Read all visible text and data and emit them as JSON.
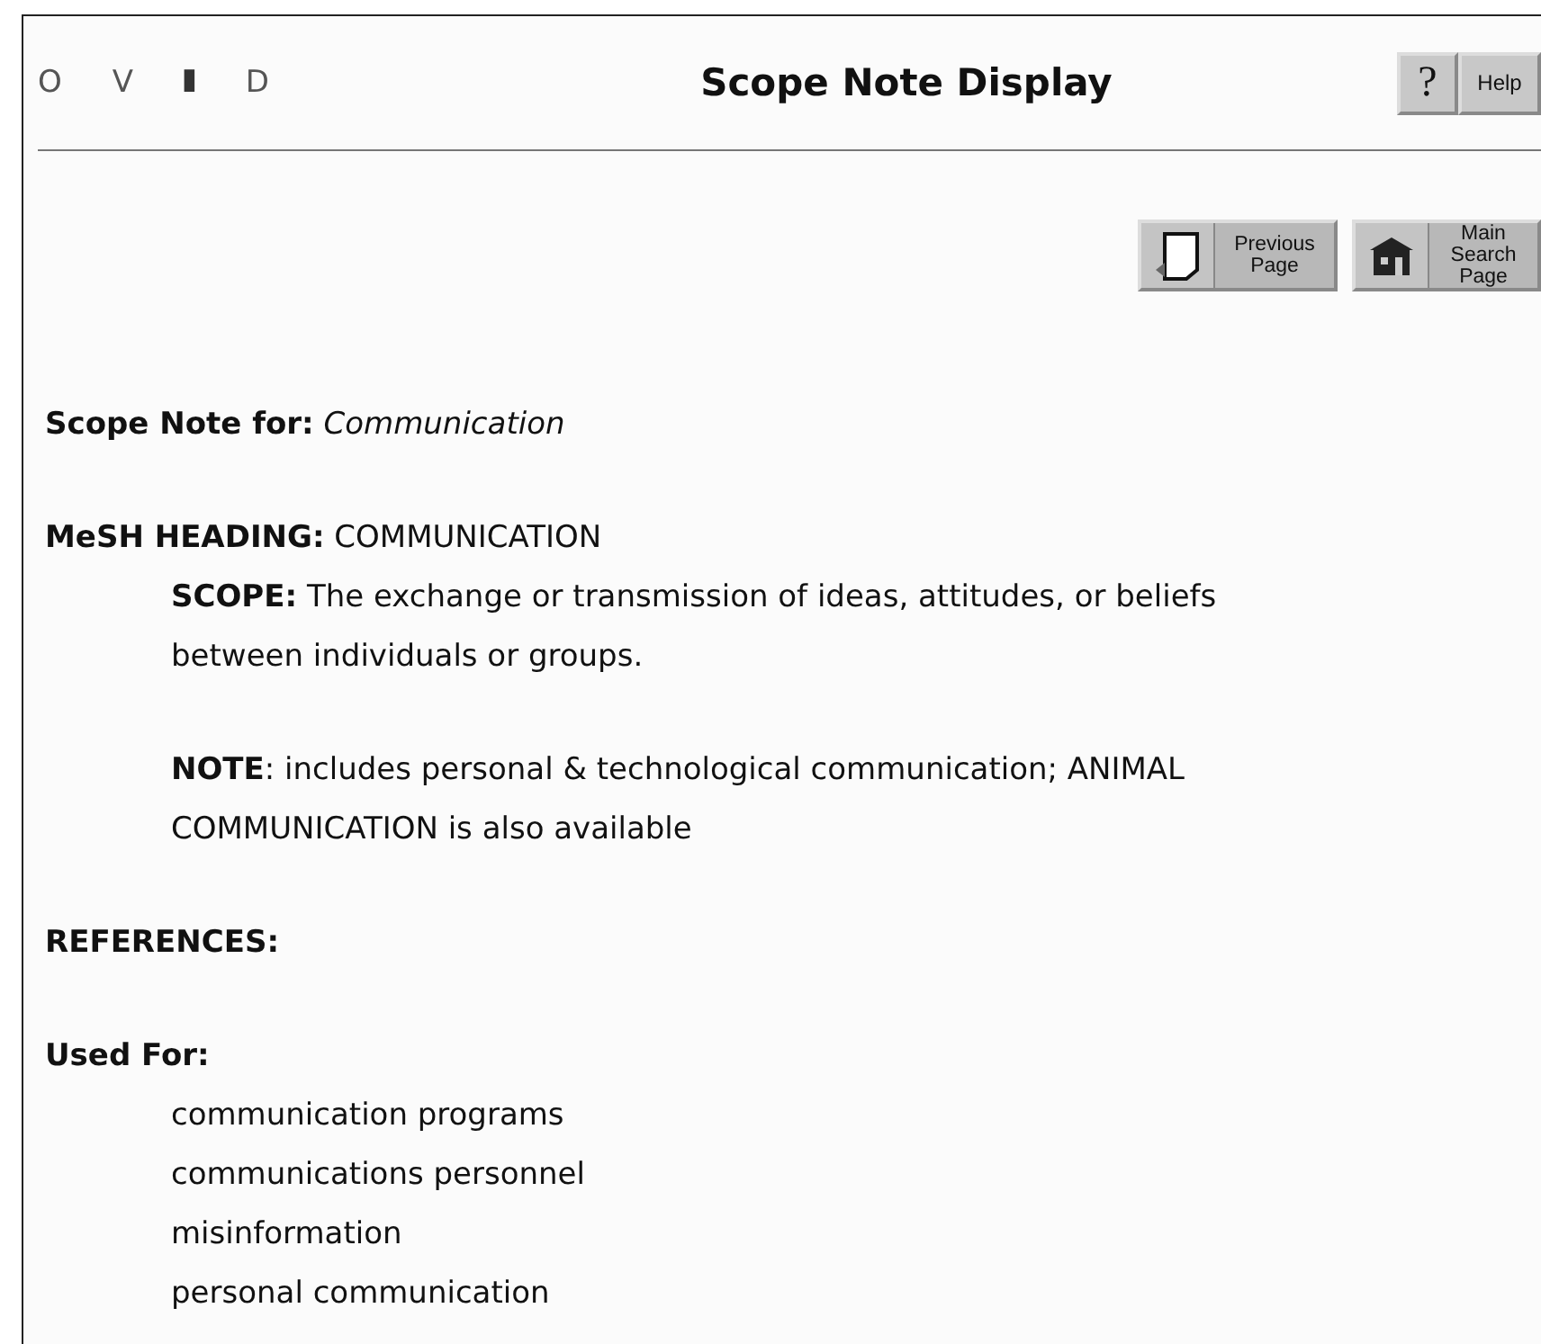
{
  "header": {
    "logo": [
      "O",
      "V",
      "I",
      "D"
    ],
    "title": "Scope Note Display",
    "help_button": {
      "mark": "?",
      "label": "Help"
    }
  },
  "nav_buttons": [
    {
      "kind": "back",
      "label": "Previous Page"
    },
    {
      "kind": "home",
      "label": "Main Search Page"
    }
  ],
  "scope_note_for": {
    "label": "Scope Note for:",
    "value": "Communication"
  },
  "mesh_heading": {
    "label": "MeSH HEADING:",
    "value": "COMMUNICATION"
  },
  "paragraphs": [
    {
      "lines": [
        "**SCOPE:** The exchange or transmission of ideas, attitudes, or beliefs",
        "between individuals or groups."
      ]
    },
    {
      "lines": [
        "**NOTE**: includes personal & technological communication; ANIMAL",
        "COMMUNICATION is also available"
      ]
    }
  ],
  "references": {
    "label": "REFERENCES:"
  },
  "used_for": {
    "label": "Used For:",
    "terms": [
      "communication programs",
      "communications personnel",
      "misinformation",
      "personal communication"
    ]
  }
}
